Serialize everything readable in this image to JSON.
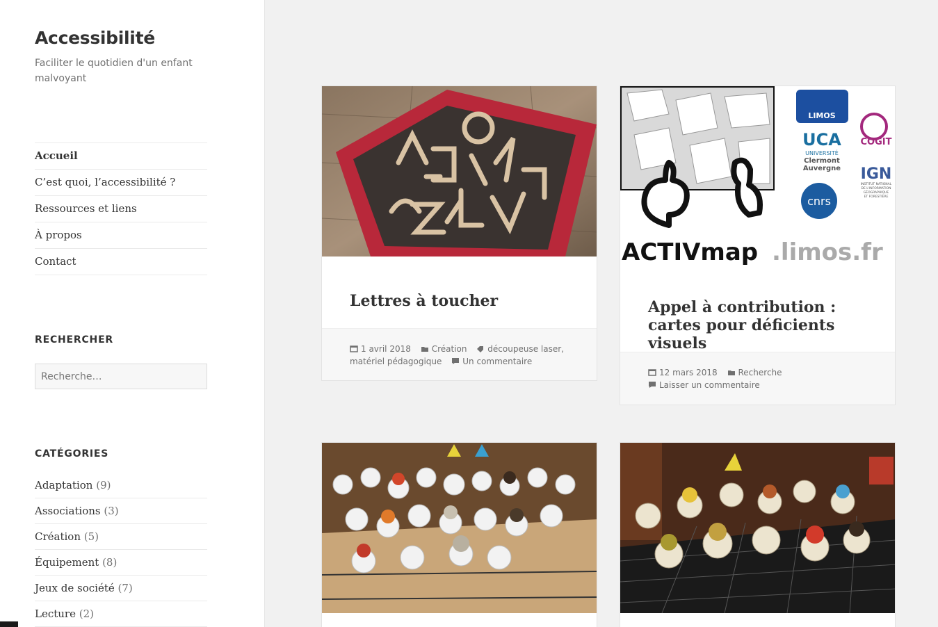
{
  "site": {
    "title": "Accessibilité",
    "description": "Faciliter le quotidien d'un enfant malvoyant"
  },
  "nav": {
    "items": [
      {
        "label": "Accueil"
      },
      {
        "label": "C’est quoi, l’accessibilité ?"
      },
      {
        "label": "Ressources et liens"
      },
      {
        "label": "À propos"
      },
      {
        "label": "Contact"
      }
    ]
  },
  "search": {
    "heading": "RECHERCHER",
    "placeholder": "Recherche…"
  },
  "categories": {
    "heading": "CATÉGORIES",
    "items": [
      {
        "name": "Adaptation",
        "count": "(9)"
      },
      {
        "name": "Associations",
        "count": "(3)"
      },
      {
        "name": "Création",
        "count": "(5)"
      },
      {
        "name": "Équipement",
        "count": "(8)"
      },
      {
        "name": "Jeux de société",
        "count": "(7)"
      },
      {
        "name": "Lecture",
        "count": "(2)"
      }
    ]
  },
  "posts": [
    {
      "title": "Lettres à toucher",
      "date": "1 avril 2018",
      "category": "Création",
      "tags": "découpeuse laser,",
      "tags2": "matériel pédagogique",
      "comments": "Un commentaire"
    },
    {
      "title": "Appel à contribution : cartes pour déficients visuels",
      "date": "12 mars 2018",
      "category": "Recherche",
      "comments": "Laisser un commentaire",
      "image": {
        "brand": "ACTIVmap",
        "domain": ".limos.fr",
        "logo_limos": "LIMOS",
        "logo_uca": "UCA",
        "logo_uca_text": "UNIVERSITÉ",
        "logo_uca_text2": "Clermont",
        "logo_uca_text3": "Auvergne",
        "logo_cogit": "COGIT",
        "logo_ign": "IGN",
        "logo_ign_text": "INSTITUT NATIONAL",
        "logo_ign_text2": "DE L'INFORMATION",
        "logo_ign_text3": "GÉOGRAPHIQUE",
        "logo_ign_text4": "ET FORESTIÈRE",
        "logo_cnrs": "cnrs"
      }
    },
    {
      "title": ""
    },
    {
      "title": ""
    }
  ]
}
